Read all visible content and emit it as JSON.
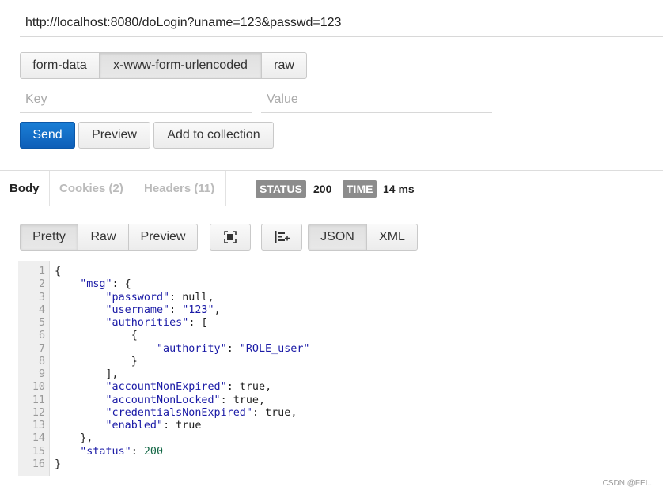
{
  "request": {
    "url": "http://localhost:8080/doLogin?uname=123&passwd=123",
    "body_types": [
      "form-data",
      "x-www-form-urlencoded",
      "raw"
    ],
    "active_body_type": "x-www-form-urlencoded",
    "key_placeholder": "Key",
    "value_placeholder": "Value",
    "send_label": "Send",
    "preview_label": "Preview",
    "add_to_collection_label": "Add to collection"
  },
  "response": {
    "tabs": [
      {
        "label": "Body",
        "active": true
      },
      {
        "label": "Cookies (2)",
        "active": false
      },
      {
        "label": "Headers (11)",
        "active": false
      }
    ],
    "status_label": "STATUS",
    "status_value": "200",
    "time_label": "TIME",
    "time_value": "14 ms",
    "view_modes": [
      "Pretty",
      "Raw",
      "Preview"
    ],
    "active_view_mode": "Pretty",
    "icon_buttons": [
      "fullscreen-icon",
      "wrap-lines-icon"
    ],
    "formats": [
      "JSON",
      "XML"
    ],
    "active_format": "JSON",
    "body_lines": [
      [
        [
          "p",
          "{"
        ]
      ],
      [
        [
          "p",
          "    "
        ],
        [
          "k",
          "\"msg\""
        ],
        [
          "p",
          ": {"
        ]
      ],
      [
        [
          "p",
          "        "
        ],
        [
          "k",
          "\"password\""
        ],
        [
          "p",
          ": "
        ],
        [
          "kw",
          "null"
        ],
        [
          "p",
          ","
        ]
      ],
      [
        [
          "p",
          "        "
        ],
        [
          "k",
          "\"username\""
        ],
        [
          "p",
          ": "
        ],
        [
          "s",
          "\"123\""
        ],
        [
          "p",
          ","
        ]
      ],
      [
        [
          "p",
          "        "
        ],
        [
          "k",
          "\"authorities\""
        ],
        [
          "p",
          ": ["
        ]
      ],
      [
        [
          "p",
          "            {"
        ]
      ],
      [
        [
          "p",
          "                "
        ],
        [
          "k",
          "\"authority\""
        ],
        [
          "p",
          ": "
        ],
        [
          "s",
          "\"ROLE_user\""
        ]
      ],
      [
        [
          "p",
          "            }"
        ]
      ],
      [
        [
          "p",
          "        ],"
        ]
      ],
      [
        [
          "p",
          "        "
        ],
        [
          "k",
          "\"accountNonExpired\""
        ],
        [
          "p",
          ": "
        ],
        [
          "kw",
          "true"
        ],
        [
          "p",
          ","
        ]
      ],
      [
        [
          "p",
          "        "
        ],
        [
          "k",
          "\"accountNonLocked\""
        ],
        [
          "p",
          ": "
        ],
        [
          "kw",
          "true"
        ],
        [
          "p",
          ","
        ]
      ],
      [
        [
          "p",
          "        "
        ],
        [
          "k",
          "\"credentialsNonExpired\""
        ],
        [
          "p",
          ": "
        ],
        [
          "kw",
          "true"
        ],
        [
          "p",
          ","
        ]
      ],
      [
        [
          "p",
          "        "
        ],
        [
          "k",
          "\"enabled\""
        ],
        [
          "p",
          ": "
        ],
        [
          "kw",
          "true"
        ]
      ],
      [
        [
          "p",
          "    },"
        ]
      ],
      [
        [
          "p",
          "    "
        ],
        [
          "k",
          "\"status\""
        ],
        [
          "p",
          ": "
        ],
        [
          "n",
          "200"
        ]
      ],
      [
        [
          "p",
          "}"
        ]
      ]
    ]
  },
  "watermark": "CSDN @FEI.."
}
